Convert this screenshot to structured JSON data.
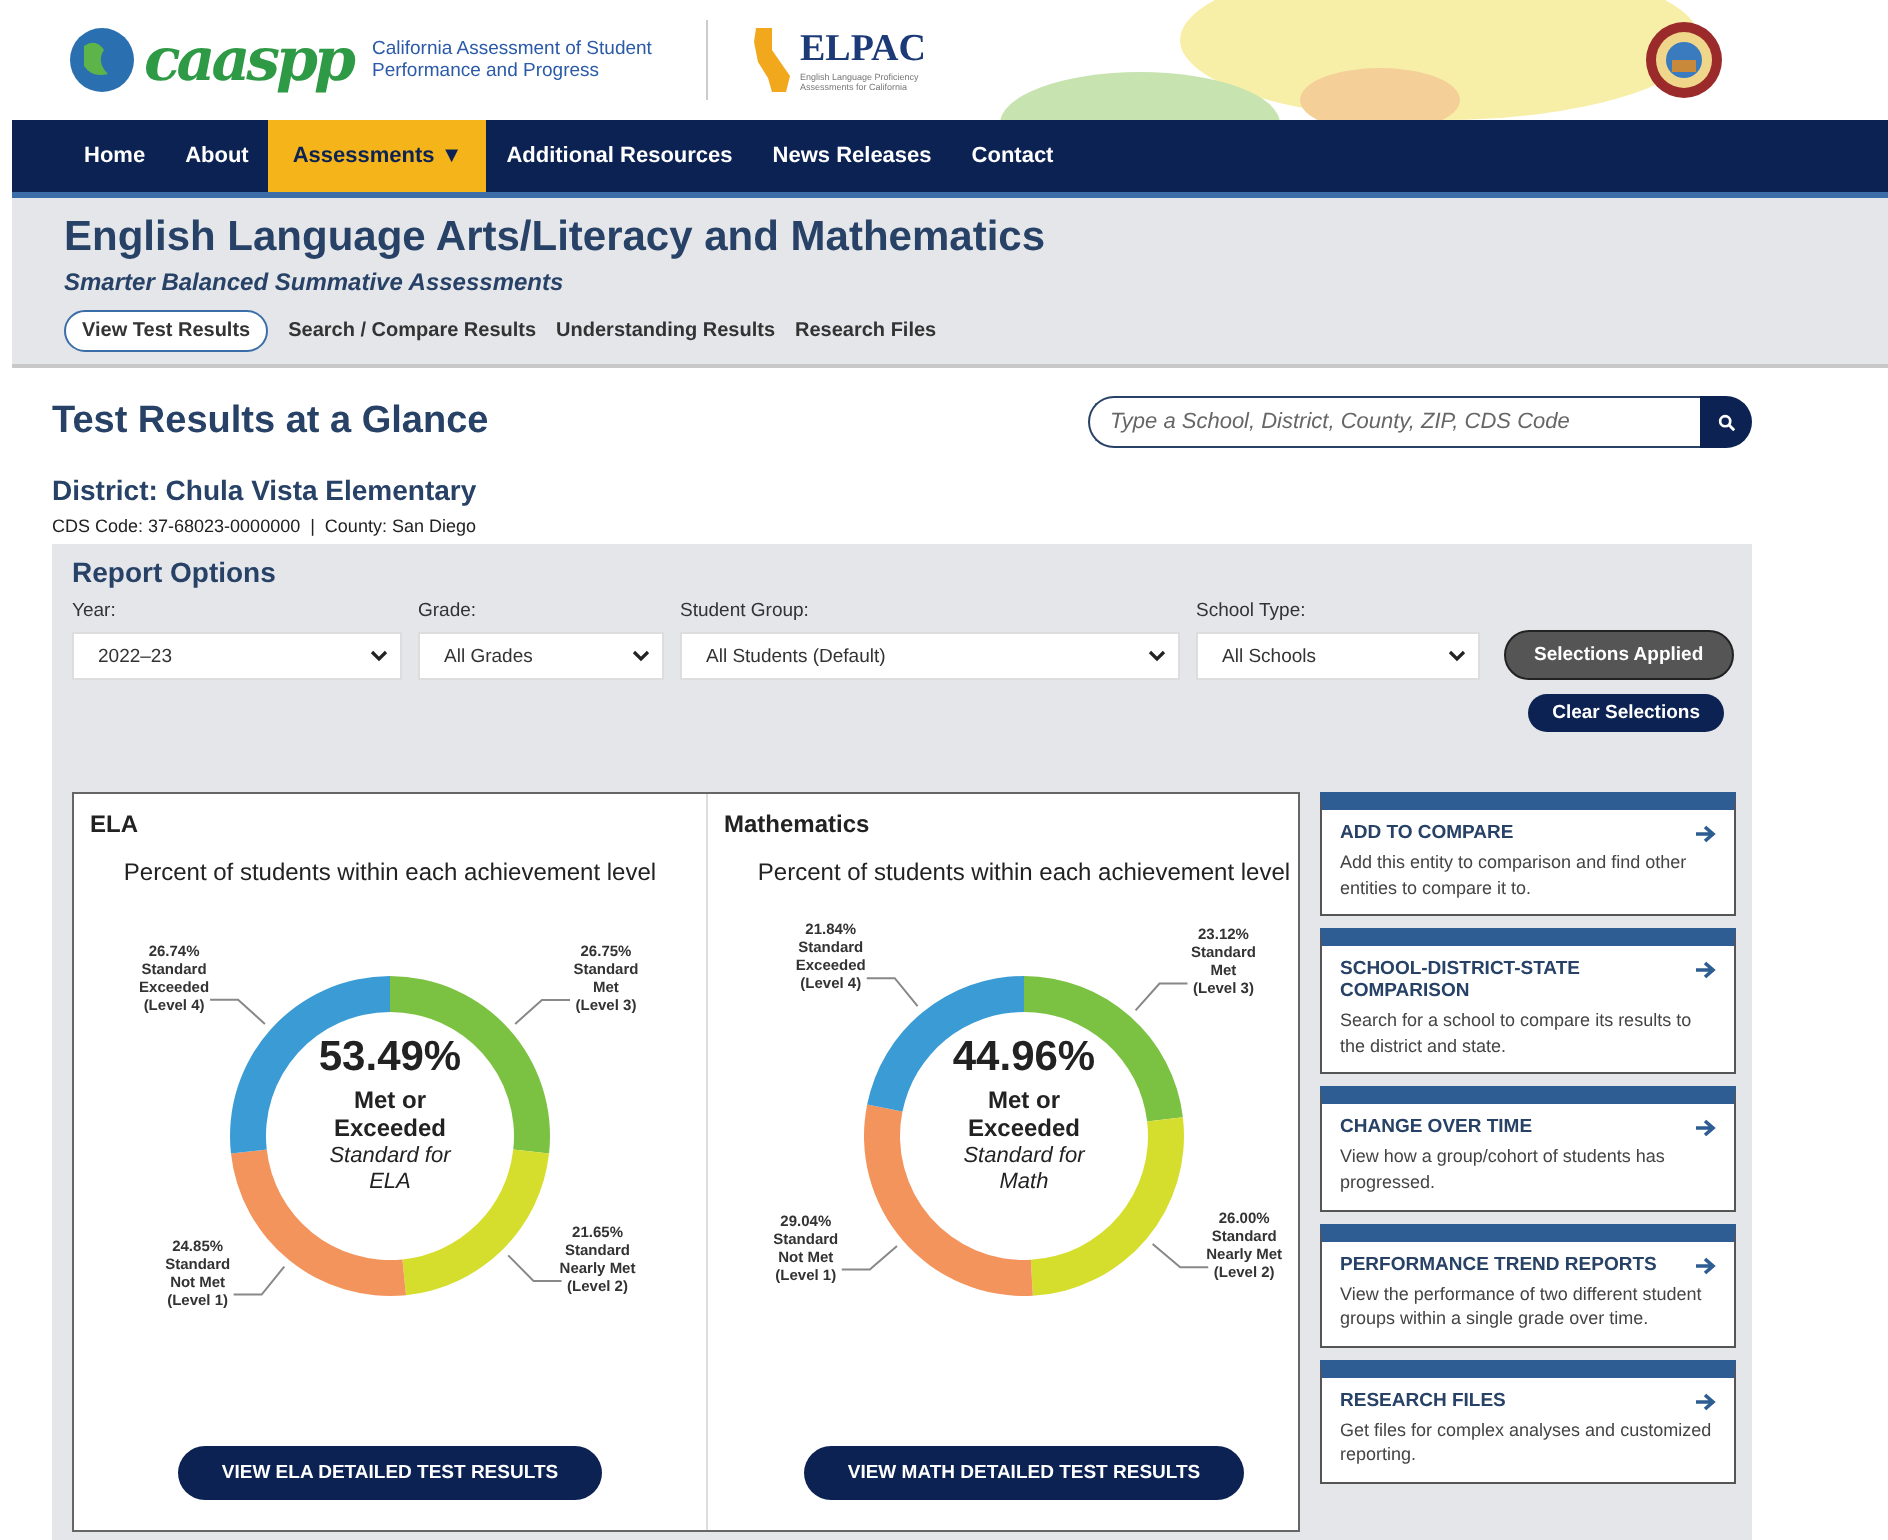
{
  "header": {
    "logo_text": "caaspp",
    "logo_caption": "California Assessment of Student Performance and Progress",
    "elpac_text": "ELPAC",
    "elpac_caption": "English Language Proficiency Assessments for California"
  },
  "nav": [
    {
      "label": "Home",
      "selected": false
    },
    {
      "label": "About",
      "selected": false
    },
    {
      "label": "Assessments ▼",
      "selected": true
    },
    {
      "label": "Additional Resources",
      "selected": false
    },
    {
      "label": "News Releases",
      "selected": false
    },
    {
      "label": "Contact",
      "selected": false
    }
  ],
  "section": {
    "title": "English Language Arts/Literacy and Mathematics",
    "subtitle": "Smarter Balanced Summative Assessments",
    "tabs": [
      {
        "label": "View Test Results",
        "selected": true
      },
      {
        "label": "Search / Compare Results",
        "selected": false
      },
      {
        "label": "Understanding Results",
        "selected": false
      },
      {
        "label": "Research Files",
        "selected": false
      }
    ]
  },
  "page_title": "Test Results at a Glance",
  "search": {
    "placeholder": "Type a School, District, County, ZIP, CDS Code"
  },
  "entity": {
    "name": "District: Chula Vista Elementary",
    "details": "CDS Code: 37-68023-0000000  |  County: San Diego"
  },
  "report_options": {
    "title": "Report Options",
    "filters": [
      {
        "label": "Year:",
        "value": "2022–23"
      },
      {
        "label": "Grade:",
        "value": "All Grades"
      },
      {
        "label": "Student Group:",
        "value": "All Students (Default)"
      },
      {
        "label": "School Type:",
        "value": "All Schools"
      }
    ],
    "apply_button": "Selections Applied",
    "clear_button": "Clear Selections"
  },
  "panels": [
    {
      "title": "ELA",
      "subtitle": "Percent of students within each achievement level",
      "center_value": "53.49%",
      "center_label": "Met or Exceeded",
      "center_note": "Standard for ELA",
      "button": "VIEW ELA DETAILED TEST RESULTS",
      "chart_data": {
        "type": "donut",
        "categories": [
          "Standard Met (Level 3)",
          "Standard Nearly Met (Level 2)",
          "Standard Not Met (Level 1)",
          "Standard Exceeded (Level 4)"
        ],
        "values": [
          26.75,
          21.65,
          24.85,
          26.74
        ],
        "value_labels": [
          "26.75%",
          "21.65%",
          "24.85%",
          "26.74%"
        ],
        "colors": [
          "#7cc242",
          "#d6de2d",
          "#f4945d",
          "#3a9bd5"
        ]
      }
    },
    {
      "title": "Mathematics",
      "subtitle": "Percent of students within each achievement level",
      "center_value": "44.96%",
      "center_label": "Met or Exceeded",
      "center_note": "Standard for Math",
      "button": "VIEW MATH DETAILED TEST RESULTS",
      "chart_data": {
        "type": "donut",
        "categories": [
          "Standard Met (Level 3)",
          "Standard Nearly Met (Level 2)",
          "Standard Not Met (Level 1)",
          "Standard Exceeded (Level 4)"
        ],
        "values": [
          23.12,
          26.0,
          29.04,
          21.84
        ],
        "value_labels": [
          "23.12%",
          "26.00%",
          "29.04%",
          "21.84%"
        ],
        "colors": [
          "#7cc242",
          "#d6de2d",
          "#f4945d",
          "#3a9bd5"
        ]
      }
    }
  ],
  "actions": [
    {
      "title": "ADD TO COMPARE",
      "description": "Add this entity to comparison and find other entities to compare it to."
    },
    {
      "title": "SCHOOL-DISTRICT-STATE COMPARISON",
      "description": "Search for a school to compare its results to the district and state."
    },
    {
      "title": "CHANGE OVER TIME",
      "description": "View how a group/cohort of students has progressed."
    },
    {
      "title": "PERFORMANCE TREND REPORTS",
      "description": "View the performance of two different student groups within a single grade over time."
    },
    {
      "title": "RESEARCH FILES",
      "description": "Get files for complex analyses and customized reporting."
    }
  ]
}
